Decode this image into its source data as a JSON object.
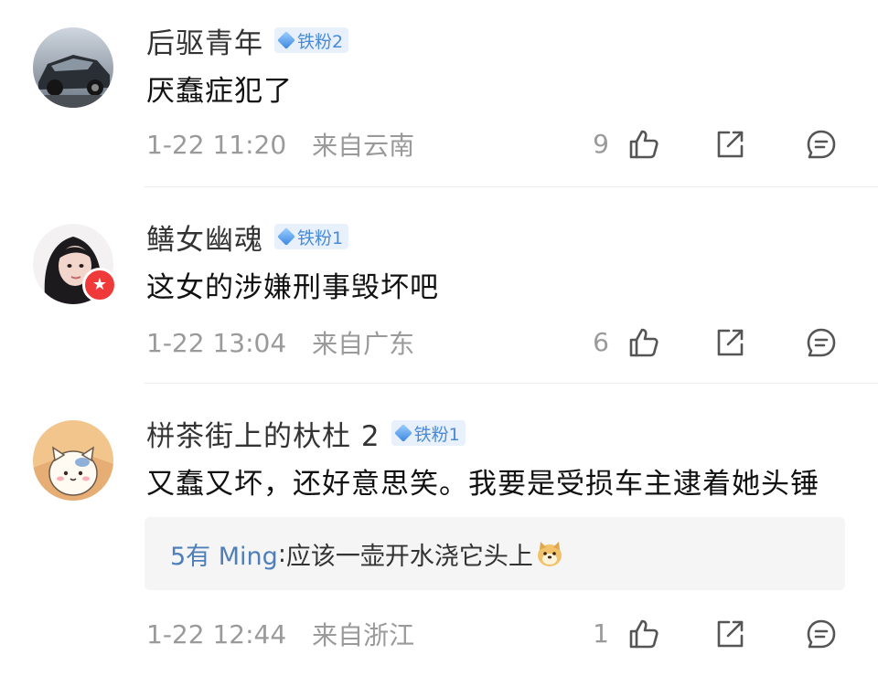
{
  "comments": [
    {
      "username": "后驱青年",
      "fan_badge": "铁粉2",
      "text": "厌蠢症犯了",
      "time": "1-22 11:20",
      "location": "来自云南",
      "likes": "9"
    },
    {
      "username": "鳝女幽魂",
      "fan_badge": "铁粉1",
      "text": "这女的涉嫌刑事毁坏吧",
      "time": "1-22 13:04",
      "location": "来自广东",
      "likes": "6"
    },
    {
      "username": "栟茶街上的杕杜 2",
      "fan_badge": "铁粉1",
      "text": "又蠢又坏，还好意思笑。我要是受损车主逮着她头锤",
      "reply": {
        "user": "5有 Ming",
        "separator": ": ",
        "text": "应该一壶开水浇它头上"
      },
      "time": "1-22 12:44",
      "location": "来自浙江",
      "likes": "1"
    }
  ],
  "icons": [
    "like-icon",
    "share-icon",
    "comment-icon"
  ],
  "colors": {
    "accent_blue": "#4a8ad6",
    "reply_user": "#4f7fb8",
    "meta_gray": "#9a9a9a",
    "verified_red": "#f03a3a"
  }
}
